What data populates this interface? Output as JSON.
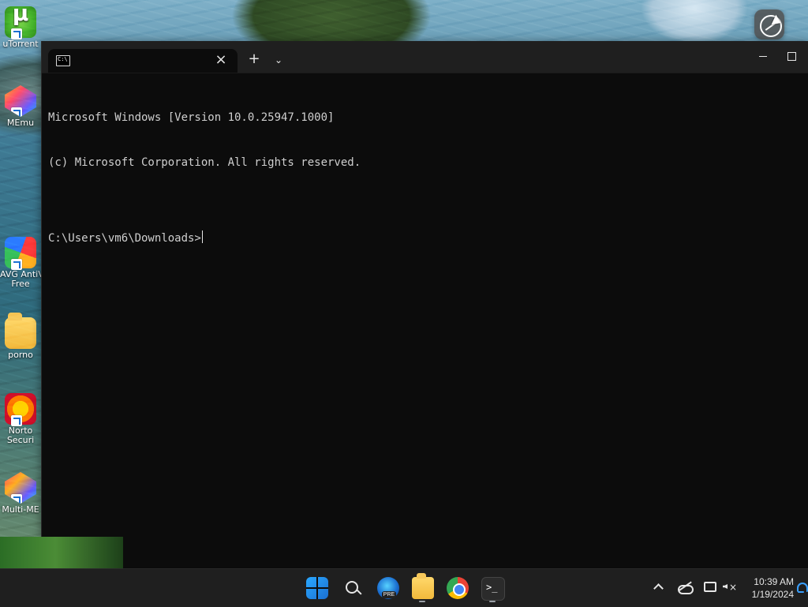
{
  "desktop": {
    "icons": [
      {
        "label": "uTorrent",
        "icon": "utorrent-icon"
      },
      {
        "label": "MEmu",
        "icon": "memu-icon"
      },
      {
        "label": "AVG AntiV\nFree",
        "icon": "avg-antivirus-icon"
      },
      {
        "label": "porno",
        "icon": "folder-icon"
      },
      {
        "label": "Norto\nSecuri",
        "icon": "norton-security-icon"
      },
      {
        "label": "Multi-ME",
        "icon": "multi-memu-icon"
      }
    ]
  },
  "terminal": {
    "tab": {
      "title": "",
      "icon": "cmd-icon"
    },
    "controls": {
      "new_tab": "+",
      "dropdown": "⌄",
      "close": "×"
    },
    "lines": [
      "Microsoft Windows [Version 10.0.25947.1000]",
      "(c) Microsoft Corporation. All rights reserved.",
      "",
      "C:\\Users\\vm6\\Downloads>"
    ]
  },
  "taskbar": {
    "pinned": [
      {
        "name": "start",
        "icon": "windows-start-icon"
      },
      {
        "name": "search",
        "icon": "search-icon"
      },
      {
        "name": "edge",
        "icon": "edge-icon",
        "badge": "PRE"
      },
      {
        "name": "file-explorer",
        "icon": "folder-icon"
      },
      {
        "name": "chrome",
        "icon": "chrome-icon"
      },
      {
        "name": "terminal",
        "icon": "terminal-icon"
      }
    ],
    "tray": {
      "time": "10:39 AM",
      "date": "1/19/2024"
    }
  }
}
